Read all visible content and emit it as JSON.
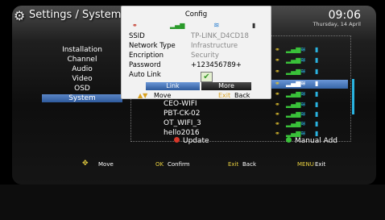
{
  "header": {
    "title": "Settings / System",
    "time": "09:06",
    "date": "Thursday, 14  April"
  },
  "menu": {
    "items": [
      "Installation",
      "Channel",
      "Audio",
      "Video",
      "OSD",
      "System"
    ],
    "selected_index": 5
  },
  "networks": {
    "visible": [
      "CEO-WIFI",
      "PBT-CK-02",
      "OT_WIFI_3",
      "hello2016"
    ],
    "selected_row": 2
  },
  "actions": {
    "update": "Update",
    "manual_add": "Manual Add"
  },
  "hints": {
    "move_key": "✥",
    "move": "Move",
    "ok_key": "OK",
    "ok": "Confirm",
    "exit_key": "Exit",
    "exit": "Back",
    "menu_key": "MENU",
    "menu": "Exit"
  },
  "popup": {
    "title": "Config",
    "labels": {
      "ssid": "SSID",
      "network_type": "Network Type",
      "encryption": "Encription",
      "password": "Password",
      "auto_link": "Auto Link"
    },
    "values": {
      "ssid": "TP-LINK_D4CD18",
      "network_type": "Infrastructure",
      "encryption": "Security",
      "password": "+123456789+"
    },
    "auto_link_checked": true,
    "checkmark": "✔",
    "buttons": {
      "link": "Link",
      "more": "More"
    },
    "hint": {
      "move_key": "▲▼",
      "move": "Move",
      "exit_key": "Exit",
      "exit": "Back"
    }
  },
  "colors": {
    "accent": "#3766a8",
    "red": "#d8382a",
    "green": "#3ac23a",
    "yellow": "#e8d040",
    "cyan": "#2ab3e0"
  }
}
